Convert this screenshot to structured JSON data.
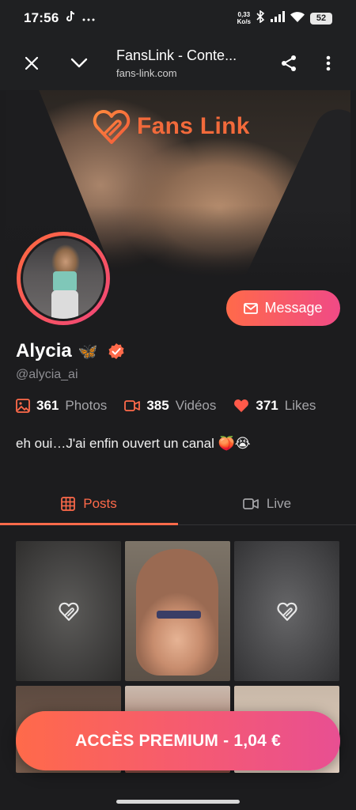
{
  "status_bar": {
    "time": "17:56",
    "net_speed_value": "0,33",
    "net_speed_unit": "Ko/s",
    "battery": "52",
    "icons": [
      "tiktok-icon",
      "more-notifications-icon",
      "bluetooth-icon",
      "signal-icon",
      "wifi-icon",
      "battery-icon"
    ]
  },
  "browser": {
    "title": "FansLink - Conte...",
    "url": "fans-link.com"
  },
  "banner": {
    "logo_text": "Fans Link"
  },
  "profile": {
    "name": "Alycia",
    "name_emoji": "🦋",
    "handle": "@alycia_ai",
    "message_label": "Message",
    "bio": "eh oui…J'ai enfin ouvert un canal 🍑😭"
  },
  "stats": {
    "photos_count": "361",
    "photos_label": "Photos",
    "videos_count": "385",
    "videos_label": "Vidéos",
    "likes_count": "371",
    "likes_label": "Likes"
  },
  "tabs": {
    "posts": "Posts",
    "live": "Live"
  },
  "premium": {
    "label": "ACCÈS PREMIUM - 1,04 €"
  },
  "colors": {
    "accent": "#ff6a4a",
    "accent_pink": "#f04a86",
    "background": "#1c1c1e"
  }
}
